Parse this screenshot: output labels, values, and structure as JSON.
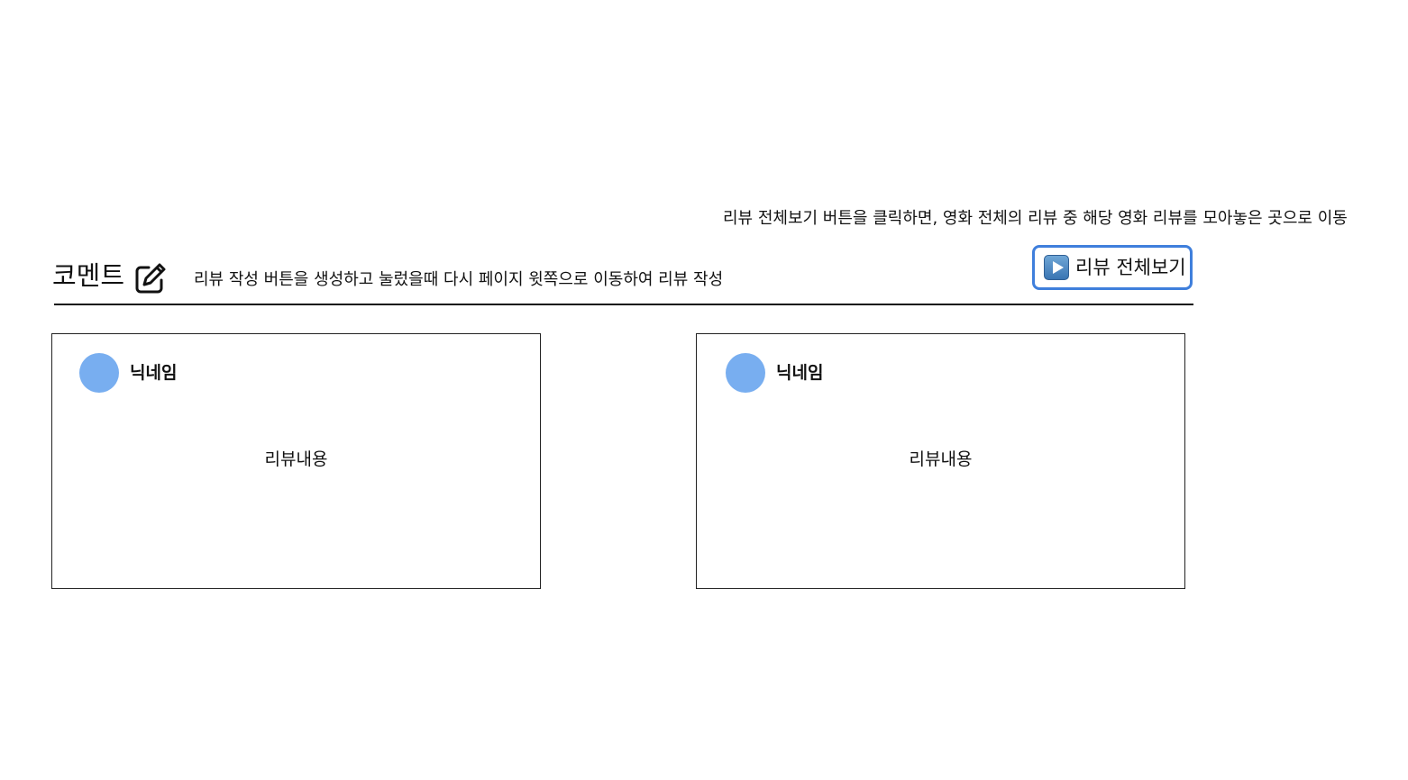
{
  "notes": {
    "view_all": "리뷰 전체보기 버튼을 클릭하면,  영화 전체의 리뷰 중 해당 영화 리뷰를 모아놓은 곳으로 이동",
    "write": "리뷰 작성 버튼을 생성하고 눌렀을때 다시 페이지 윗쪽으로 이동하여 리뷰 작성"
  },
  "section": {
    "title": "코멘트",
    "edit_icon": "pencil-square-icon"
  },
  "view_all_button": {
    "icon": "play-button-icon",
    "label": "리뷰 전체보기",
    "border_color": "#3f7fdc"
  },
  "reviews": [
    {
      "nickname": "닉네임",
      "content": "리뷰내용",
      "avatar_color": "#78aef0"
    },
    {
      "nickname": "닉네임",
      "content": "리뷰내용",
      "avatar_color": "#78aef0"
    }
  ]
}
